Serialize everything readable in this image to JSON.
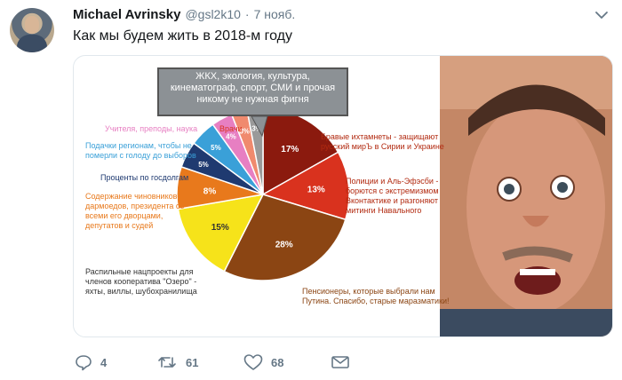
{
  "tweet": {
    "author_name": "Michael Avrinsky",
    "handle": "@gsl2k10",
    "separator": "·",
    "date": "7 нояб.",
    "text": "Как мы будем жить в 2018-м году"
  },
  "image": {
    "callout": "ЖКХ, экология, культура,\nкинематограф, спорт, СМИ и прочая\nникому не нужная фигня",
    "slice_labels": [
      "17%",
      "13%",
      "28%",
      "15%",
      "8%",
      "5%",
      "5%",
      "4%",
      "3%",
      "3%"
    ],
    "annotations": {
      "brave": "Бравые ихтамнеты - защищают\nрусский мирЪ в Сирии и Украине",
      "police": "Полиции и Аль-Эфэсби -\nборются с экстремизмом\nВконтактике и разгоняют\nмитинги Навального",
      "pensioners": "Пенсионеры, которые выбрали нам\nПутина. Спасибо, старые маразматики!",
      "nacprojects": "Распильные нацпроекты для\nчленов кооператива \"Озеро\" -\nяхты, виллы, шубохранилища",
      "officials": "Содержание чиновников-\nдармоедов, президента со\nвсеми его дворцами,\nдепутатов и судей",
      "interest": "Проценты по госдолгам",
      "regions": "Подачки регионам, чтобы не\nпомерли с голоду до выборов",
      "teachers": "Учителя, преподы, наука",
      "doctors": "Врачи"
    },
    "colors": {
      "dark_red": "#8b1a0e",
      "red": "#d9321e",
      "brown": "#8b4513",
      "yellow": "#f6e31a",
      "orange": "#e8791c",
      "navy": "#1f3a70",
      "light_blue": "#3aa0d8",
      "pink": "#e77fc2",
      "salmon": "#f08a6e",
      "grey": "#9a9a9a"
    }
  },
  "actions": {
    "replies": "4",
    "retweets": "61",
    "likes": "68"
  },
  "icons": [
    "caret-down-icon",
    "reply-icon",
    "retweet-icon",
    "heart-icon",
    "envelope-icon"
  ]
}
